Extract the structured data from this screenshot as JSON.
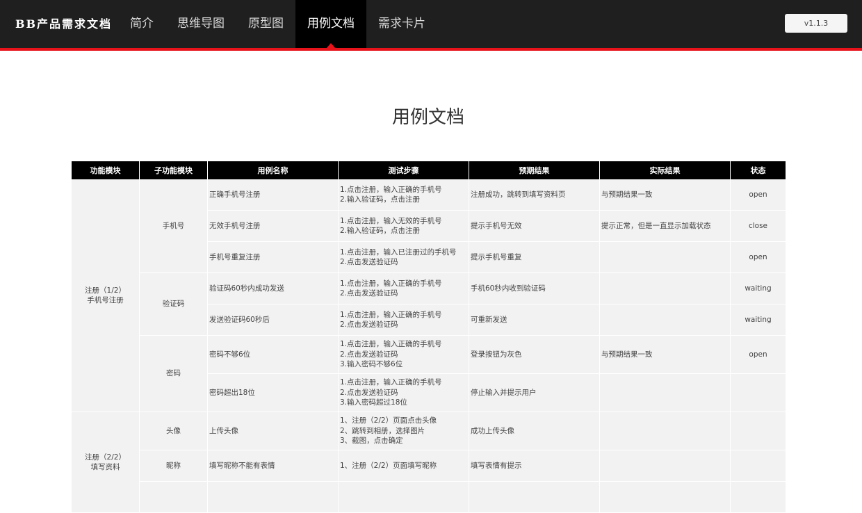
{
  "header": {
    "logo": "BB产品需求文档",
    "nav": [
      {
        "label": "简介"
      },
      {
        "label": "思维导图"
      },
      {
        "label": "原型图"
      },
      {
        "label": "用例文档"
      },
      {
        "label": "需求卡片"
      }
    ],
    "version": "v1.1.3"
  },
  "page": {
    "title": "用例文档"
  },
  "table": {
    "columns": [
      "功能模块",
      "子功能模块",
      "用例名称",
      "测试步骤",
      "预期结果",
      "实际结果",
      "状态"
    ],
    "groups": [
      {
        "module": "注册（1/2）",
        "module_sub": "手机号注册"
      },
      {
        "module": "注册（2/2）",
        "module_sub": "填写资料"
      }
    ],
    "subs": [
      "手机号",
      "验证码",
      "密码",
      "头像",
      "昵称"
    ],
    "rows": [
      {
        "name": "正确手机号注册",
        "steps": [
          "1.点击注册，输入正确的手机号",
          "2.输入验证码，点击注册"
        ],
        "expected": "注册成功，跳转到填写资料页",
        "actual": "与预期结果一致",
        "status": "open"
      },
      {
        "name": "无效手机号注册",
        "steps": [
          "1.点击注册，输入无效的手机号",
          "2.输入验证码，点击注册"
        ],
        "expected": "提示手机号无效",
        "actual": "提示正常，但是一直显示加载状态",
        "status": "close"
      },
      {
        "name": "手机号重复注册",
        "steps": [
          "1.点击注册，输入已注册过的手机号",
          "2.点击发送验证码"
        ],
        "expected": "提示手机号重复",
        "actual": "",
        "status": "open"
      },
      {
        "name": "验证码60秒内成功发送",
        "steps": [
          "1.点击注册，输入正确的手机号",
          "2.点击发送验证码"
        ],
        "expected": "手机60秒内收到验证码",
        "actual": "",
        "status": "waiting"
      },
      {
        "name": "发送验证码60秒后",
        "steps": [
          "1.点击注册，输入正确的手机号",
          "2.点击发送验证码"
        ],
        "expected": "可重新发送",
        "actual": "",
        "status": "waiting"
      },
      {
        "name": "密码不够6位",
        "steps": [
          "1.点击注册，输入正确的手机号",
          "2.点击发送验证码",
          "3.输入密码不够6位"
        ],
        "expected": "登录按钮为灰色",
        "actual": "与预期结果一致",
        "status": "open"
      },
      {
        "name": "密码超出18位",
        "steps": [
          "1.点击注册，输入正确的手机号",
          "2.点击发送验证码",
          "3.输入密码超过18位"
        ],
        "expected": "停止输入并提示用户",
        "actual": "",
        "status": ""
      },
      {
        "name": "上传头像",
        "steps": [
          "1、注册（2/2）页面点击头像",
          "2、跳转到相册，选择图片",
          "3、截图，点击确定"
        ],
        "expected": "成功上传头像",
        "actual": "",
        "status": ""
      },
      {
        "name": "填写昵称不能有表情",
        "steps": [
          "1、注册（2/2）页面填写昵称"
        ],
        "expected": "填写表情有提示",
        "actual": "",
        "status": ""
      }
    ]
  }
}
